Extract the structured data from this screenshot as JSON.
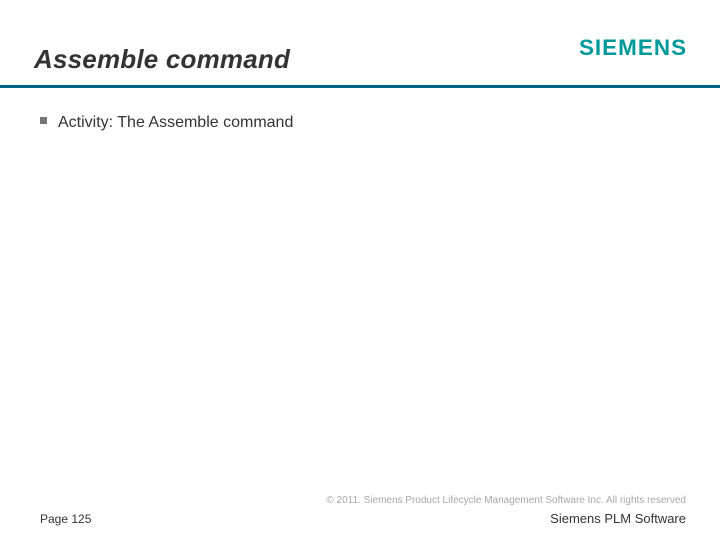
{
  "header": {
    "title": "Assemble command",
    "logo_text": "SIEMENS"
  },
  "body": {
    "bullets": [
      {
        "label": "Activity: The Assemble command"
      }
    ]
  },
  "footer": {
    "copyright": "© 2011. Siemens Product Lifecycle Management Software Inc. All rights reserved",
    "product": "Siemens PLM Software",
    "page_label": "Page 125"
  }
}
